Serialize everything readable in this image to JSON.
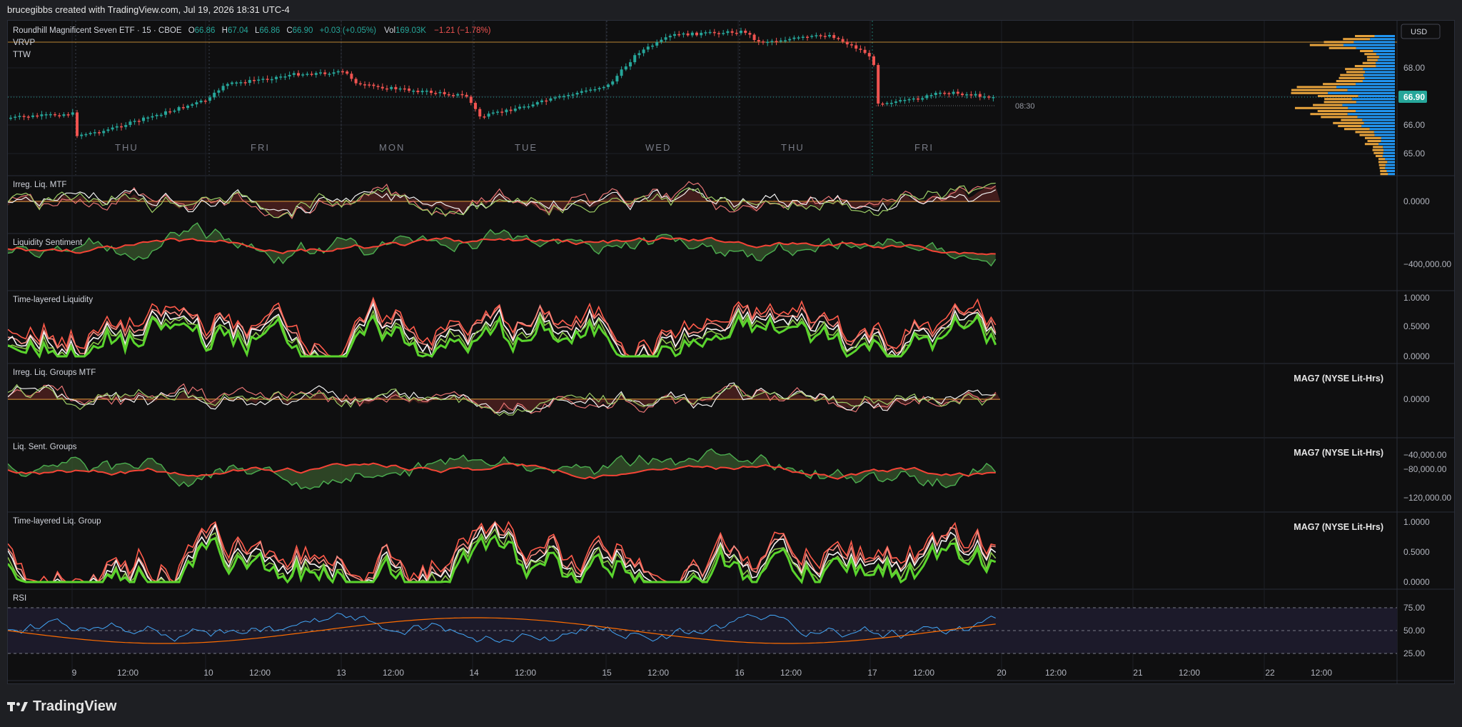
{
  "header": {
    "caption": "brucegibbs created with TradingView.com, Jul 19, 2026 18:31 UTC-4"
  },
  "legend": {
    "symbol": "Roundhill Magnificent Seven ETF · 15 · CBOE",
    "o_label": "O",
    "o_val": "66.86",
    "h_label": "H",
    "h_val": "67.04",
    "l_label": "L",
    "l_val": "66.86",
    "c_label": "C",
    "c_val": "66.90",
    "change": "+0.03 (+0.05%)",
    "vol_label": "Vol",
    "vol_val": "169.03K",
    "vol_change": "−1.21 (−1.78%)",
    "indicator1": "VRVP",
    "indicator2": "TTW"
  },
  "currency_button": "USD",
  "price_axis": {
    "ticks": [
      "68.00",
      "66.00",
      "65.00"
    ],
    "last_price": "66.90",
    "session_time": "08:30"
  },
  "day_labels": [
    "THU",
    "FRI",
    "MON",
    "TUE",
    "WED",
    "THU",
    "FRI"
  ],
  "panes": [
    {
      "title": "Irreg. Liq. MTF",
      "ticks": [
        "0.0000"
      ],
      "label": ""
    },
    {
      "title": "Liquidity Sentiment",
      "ticks": [
        "−400,000.00"
      ],
      "label": ""
    },
    {
      "title": "Time-layered Liquidity",
      "ticks": [
        "1.0000",
        "0.5000",
        "0.0000"
      ],
      "label": ""
    },
    {
      "title": "Irreg. Liq. Groups MTF",
      "ticks": [
        "0.0000"
      ],
      "label": "MAG7 (NYSE Lit-Hrs)"
    },
    {
      "title": "Liq. Sent. Groups",
      "ticks": [
        "−40,000.00",
        "−80,000.00",
        "−120,000.00"
      ],
      "label": "MAG7 (NYSE Lit-Hrs)"
    },
    {
      "title": "Time-layered Liq. Group",
      "ticks": [
        "1.0000",
        "0.5000",
        "0.0000"
      ],
      "label": "MAG7 (NYSE Lit-Hrs)"
    },
    {
      "title": "RSI",
      "ticks": [
        "75.00",
        "50.00",
        "25.00"
      ],
      "label": ""
    }
  ],
  "time_axis": [
    "9",
    "12:00",
    "10",
    "12:00",
    "13",
    "12:00",
    "14",
    "12:00",
    "15",
    "12:00",
    "16",
    "12:00",
    "17",
    "12:00",
    "20",
    "12:00",
    "21",
    "12:00",
    "22",
    "12:00"
  ],
  "footer": {
    "brand": "TradingView"
  },
  "colors": {
    "up": "#26a69a",
    "down": "#ef5350",
    "accent": "#e6a23c",
    "vp_up": "#2196f3",
    "vp_down": "#e6a23c"
  }
}
